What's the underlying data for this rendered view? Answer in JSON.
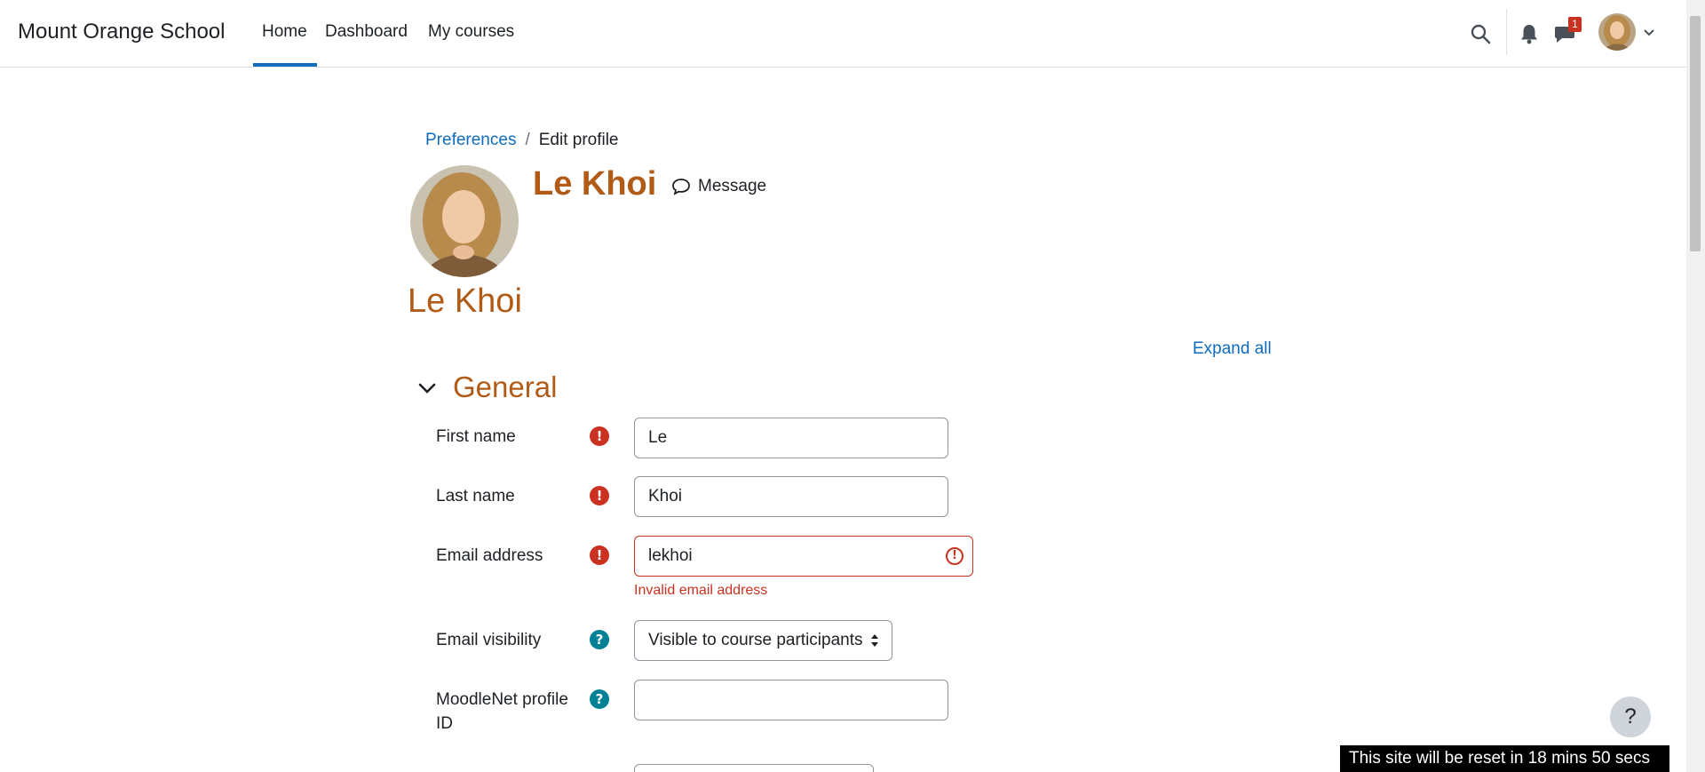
{
  "navbar": {
    "brand": "Mount Orange School",
    "links": [
      "Home",
      "Dashboard",
      "My courses"
    ],
    "active_link": "Home",
    "messages_badge": "1"
  },
  "breadcrumb": {
    "items": [
      "Preferences",
      "Edit profile"
    ]
  },
  "profile": {
    "name": "Le Khoi",
    "message_label": "Message"
  },
  "page_heading": "Le Khoi",
  "expand_all": "Expand all",
  "section": {
    "title": "General",
    "fields": {
      "first_name": {
        "label": "First name",
        "value": "Le"
      },
      "last_name": {
        "label": "Last name",
        "value": "Khoi"
      },
      "email": {
        "label": "Email address",
        "value": "lekhoi",
        "error": "Invalid email address"
      },
      "email_visibility": {
        "label": "Email visibility",
        "value": "Visible to course participants"
      },
      "moodlenet": {
        "label": "MoodleNet profile ID",
        "value": ""
      }
    }
  },
  "help_button": "?",
  "reset_banner": "This site will be reset in 18 mins 50 secs",
  "colors": {
    "accent": "#0f6cbf",
    "heading": "#b25b17",
    "error": "#ca3120",
    "help": "#008196"
  }
}
